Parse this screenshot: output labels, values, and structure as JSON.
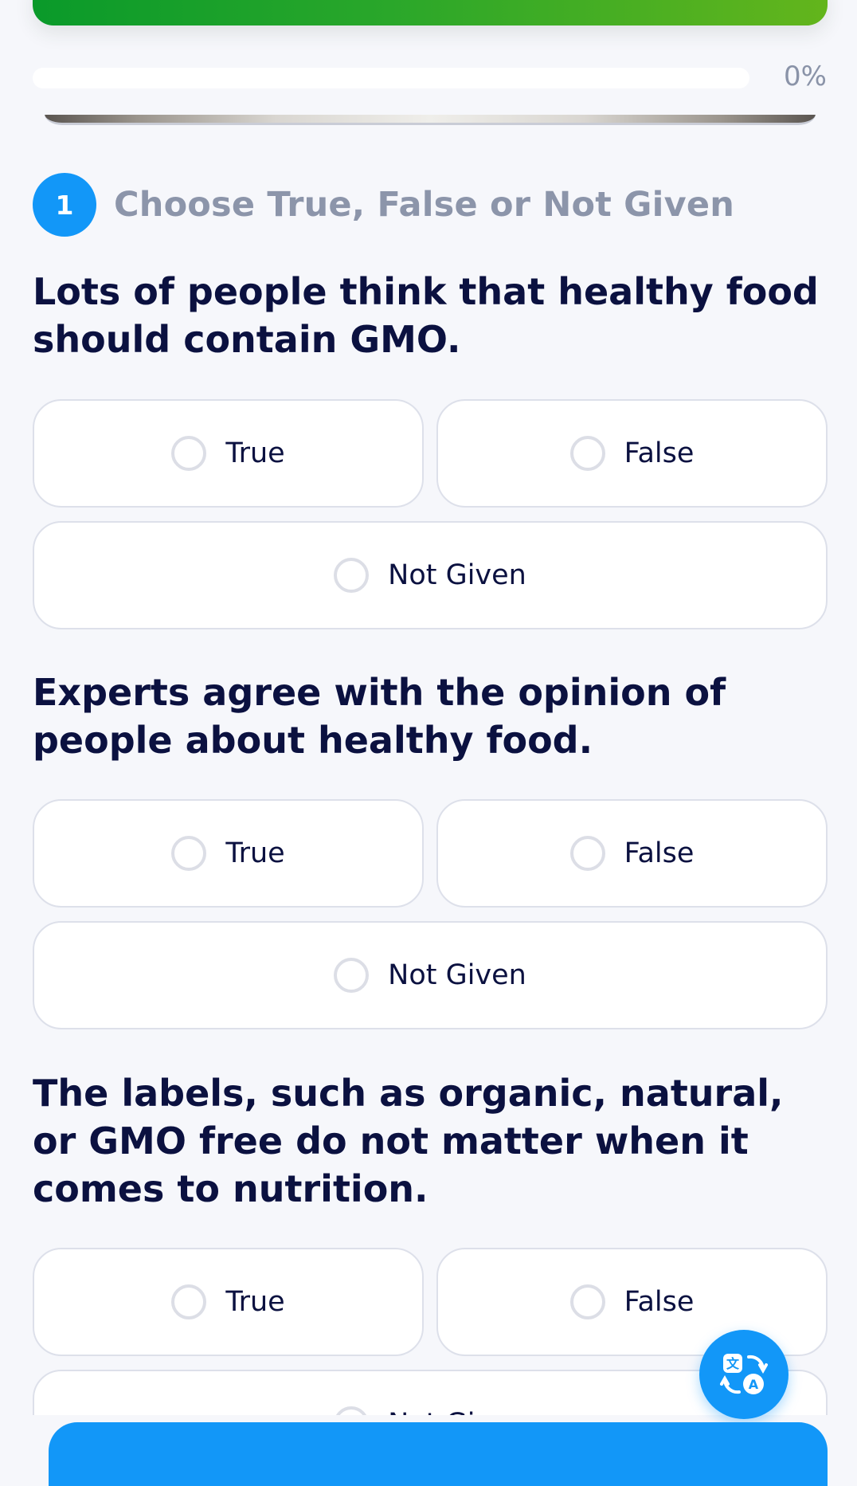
{
  "progress": {
    "percent_label": "0%",
    "value": 0
  },
  "section": {
    "number": "1",
    "title": "Choose True, False or Not Given"
  },
  "questions": [
    {
      "text": "Lots of people think that healthy food should contain GMO.",
      "options": [
        "True",
        "False",
        "Not Given"
      ]
    },
    {
      "text": "Experts agree with the opinion of people about healthy food.",
      "options": [
        "True",
        "False",
        "Not Given"
      ]
    },
    {
      "text": "The labels, such as organic, natural, or GMO free do not matter when it comes to nutrition.",
      "options": [
        "True",
        "False",
        "Not Given"
      ]
    }
  ],
  "icons": {
    "fab": "translate-icon",
    "radio": "radio-unchecked-icon"
  },
  "colors": {
    "accent": "#1297f8",
    "green_start": "#0a9a2a",
    "green_end": "#63b51c",
    "text": "#0b1140",
    "muted": "#8c95aa"
  }
}
